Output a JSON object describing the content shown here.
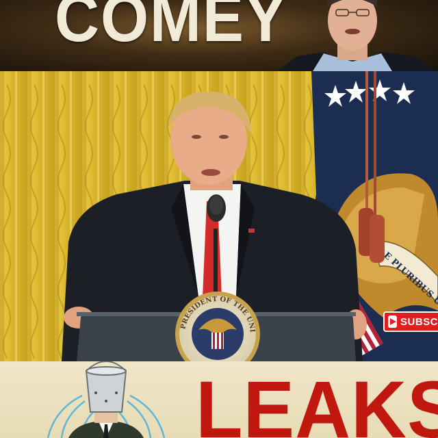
{
  "top_banner": {
    "title": "COMEY"
  },
  "main_frame": {
    "seal_text": "THE PRESIDENT OF THE UNITED",
    "flag_motto": "E PLURIBUS UNUM",
    "subscribe_label": "SUBSC",
    "subscribe_icon": "play-icon",
    "colors": {
      "curtain": "#d9b62a",
      "suit": "#1d1f26",
      "tie": "#d42a2a",
      "flag_blue": "#1c2d52",
      "subscribe": "#e21d1d"
    }
  },
  "bottom_banner": {
    "title": "LEAKS",
    "illustration": "leaking-bucket-icon",
    "colors": {
      "title": "#c0170f",
      "background": "#efe6c8"
    }
  }
}
